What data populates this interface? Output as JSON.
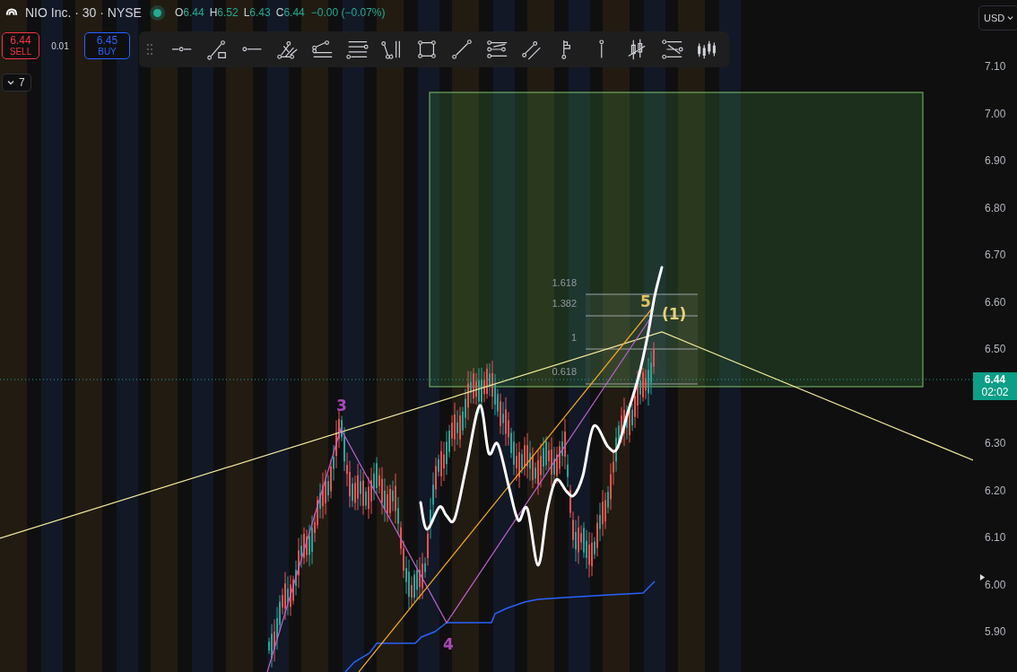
{
  "symbol": {
    "title": "NIO Inc. · 30 · NYSE",
    "market_open": true,
    "ohlc": [
      {
        "label": "O",
        "value": "6.44"
      },
      {
        "label": "H",
        "value": "6.52"
      },
      {
        "label": "L",
        "value": "6.43"
      },
      {
        "label": "C",
        "value": "6.44"
      }
    ],
    "change": "−0.00 (−0.07%)"
  },
  "trade": {
    "sell": {
      "price": "6.44",
      "label": "SELL"
    },
    "spread": "0.01",
    "buy": {
      "price": "6.45",
      "label": "BUY"
    }
  },
  "indicators_toggle": {
    "count": "7",
    "expanded": false
  },
  "drawing_toolbar": {
    "tools": [
      {
        "kind": "horizontal-ray"
      },
      {
        "kind": "trend-line-note"
      },
      {
        "kind": "horizontal-line"
      },
      {
        "kind": "pitchfork"
      },
      {
        "kind": "fib-channel"
      },
      {
        "kind": "parallel-lines"
      },
      {
        "kind": "elliott"
      },
      {
        "kind": "rectangle"
      },
      {
        "kind": "trend-line"
      },
      {
        "kind": "fib-levels"
      },
      {
        "kind": "parallel-channel"
      },
      {
        "kind": "flag"
      },
      {
        "kind": "vertical-pin"
      },
      {
        "kind": "candle-cross"
      },
      {
        "kind": "levels-projection"
      },
      {
        "kind": "candles"
      }
    ]
  },
  "currency": "USD",
  "price_axis": {
    "labels": [
      "7.10",
      "7.00",
      "6.90",
      "6.80",
      "6.70",
      "6.60",
      "6.50",
      "6.30",
      "6.20",
      "6.10",
      "6.00",
      "5.90"
    ]
  },
  "last_price": {
    "price": "6.44",
    "countdown": "02:02"
  },
  "fibonacci": {
    "levels": [
      "1.618",
      "1.382",
      "1",
      "0.618"
    ]
  },
  "wave_labels": [
    {
      "text": "3",
      "color": "#ab47bc"
    },
    {
      "text": "4",
      "color": "#ab47bc"
    },
    {
      "text": "5",
      "color": "#e6c35c"
    },
    {
      "text": "(1)",
      "color": "#e6d37a"
    }
  ]
}
